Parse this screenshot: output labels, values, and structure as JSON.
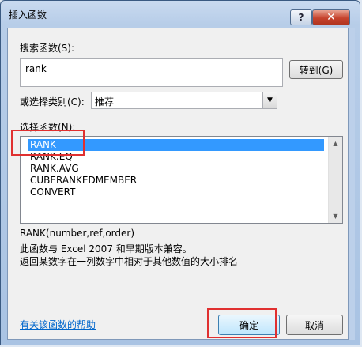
{
  "window": {
    "title": "插入函数",
    "help_glyph": "?",
    "close_glyph": "✕"
  },
  "search": {
    "label": "搜索函数(S):",
    "value": "rank",
    "go_label": "转到(G)"
  },
  "category": {
    "label": "或选择类别(C):",
    "selected": "推荐"
  },
  "functions": {
    "label": "选择函数(N):",
    "items": [
      "RANK",
      "RANK.EQ",
      "RANK.AVG",
      "CUBERANKEDMEMBER",
      "CONVERT"
    ],
    "selected_index": 0
  },
  "details": {
    "signature": "RANK(number,ref,order)",
    "line1": "此函数与 Excel 2007 和早期版本兼容。",
    "line2": "返回某数字在一列数字中相对于其他数值的大小排名"
  },
  "footer": {
    "help_link": "有关该函数的帮助",
    "ok_label": "确定",
    "cancel_label": "取消"
  },
  "colors": {
    "highlight": "#e03030",
    "selection": "#3399ff",
    "link": "#0066cc"
  }
}
